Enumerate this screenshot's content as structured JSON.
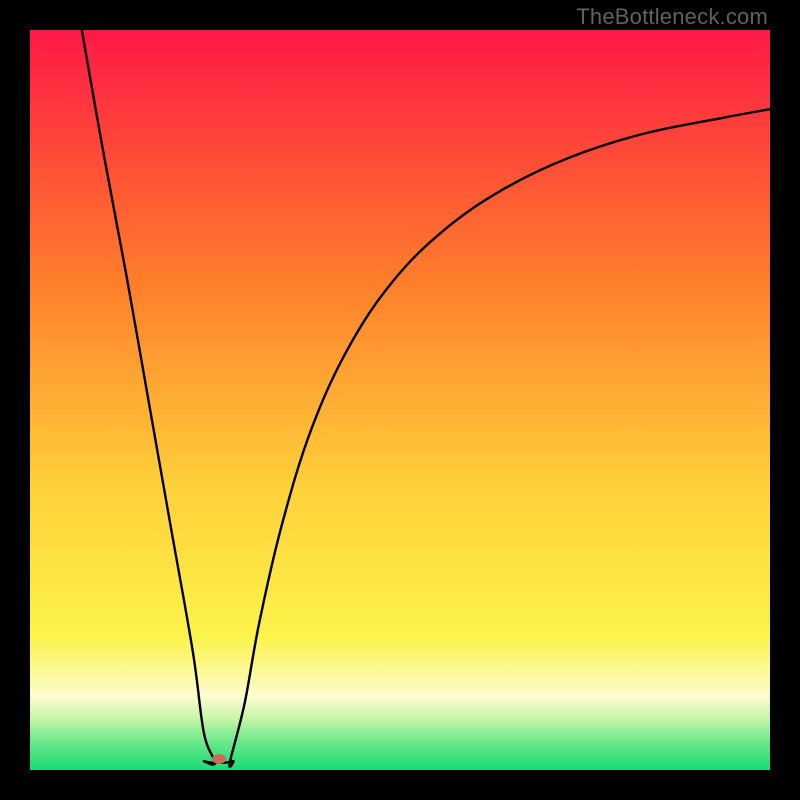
{
  "watermark": "TheBottleneck.com",
  "colors": {
    "top": "#ff1846",
    "mid1": "#ff8a2a",
    "mid2": "#ffe23a",
    "pale": "#fdfccf",
    "green": "#26e07a",
    "curve": "#000000",
    "bg": "#000000",
    "marker": "#cc6b59"
  },
  "chart_data": {
    "type": "line",
    "title": "",
    "xlabel": "",
    "ylabel": "",
    "xlim": [
      0,
      100
    ],
    "ylim": [
      0,
      100
    ],
    "annotations": [
      {
        "text": "TheBottleneck.com",
        "x": 100,
        "y": 100,
        "ha": "right",
        "va": "top"
      }
    ],
    "marker": {
      "x": 25.5,
      "y": 1.5
    },
    "series": [
      {
        "name": "left-branch",
        "x": [
          7,
          10,
          13,
          16,
          19,
          22,
          23.5,
          25
        ],
        "y": [
          100,
          83,
          67,
          50,
          33,
          16,
          5,
          1
        ]
      },
      {
        "name": "valley-floor",
        "x": [
          23.5,
          24.5,
          25.5,
          26.5,
          27.5
        ],
        "y": [
          1.2,
          1.0,
          1.0,
          1.0,
          1.2
        ]
      },
      {
        "name": "right-branch",
        "x": [
          27,
          29,
          31,
          34,
          38,
          43,
          49,
          56,
          64,
          73,
          83,
          94,
          100
        ],
        "y": [
          1,
          9,
          20,
          33,
          46,
          57,
          66,
          73,
          78.5,
          82.8,
          86,
          88.2,
          89.3
        ]
      }
    ]
  }
}
